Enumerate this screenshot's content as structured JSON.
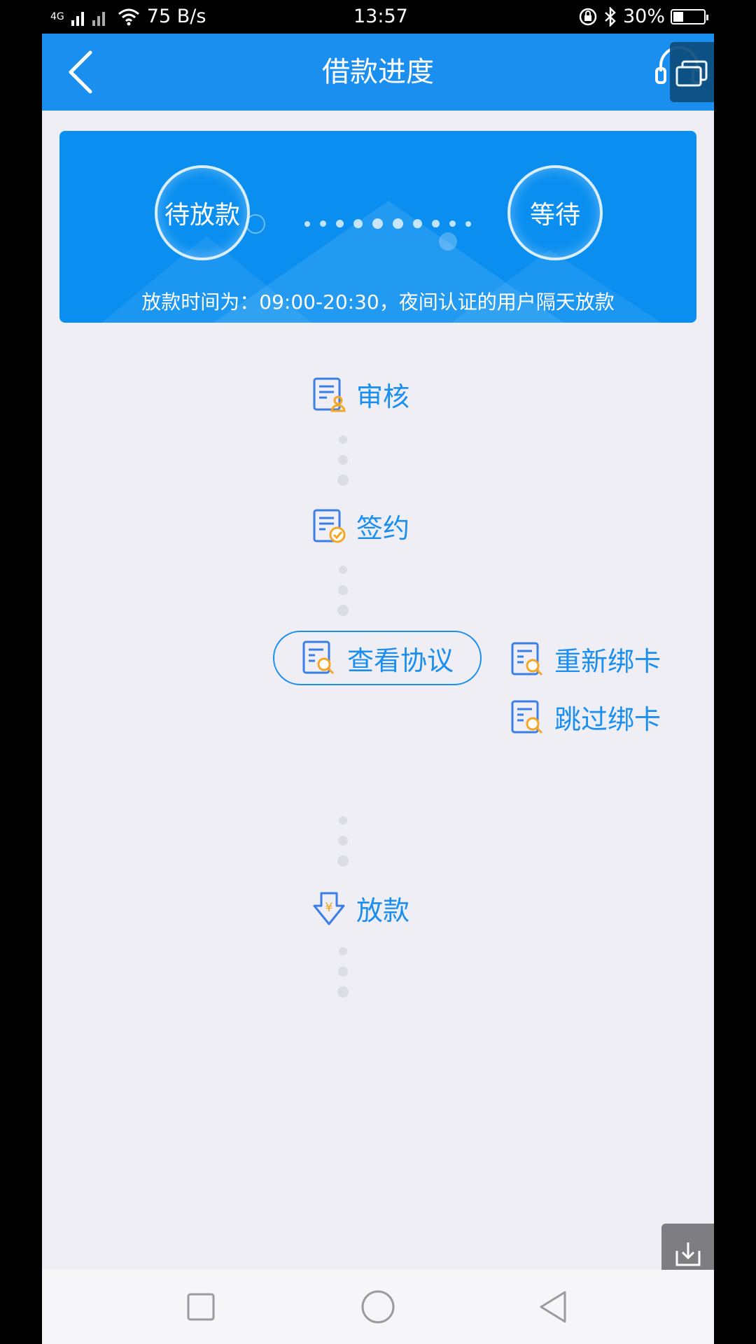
{
  "status_bar": {
    "network": "4G",
    "speed": "75 B/s",
    "time": "13:57",
    "battery": "30%",
    "battery_level": 0.3
  },
  "header": {
    "title": "借款进度"
  },
  "status_card": {
    "current_state": "待放款",
    "next_state": "等待",
    "note": "放款时间为：09:00-20:30，夜间认证的用户隔天放款"
  },
  "steps": {
    "review": "审核",
    "sign": "签约",
    "view_agreement": "查看协议",
    "rebind_card": "重新绑卡",
    "skip_bind_card": "跳过绑卡",
    "disburse": "放款"
  },
  "colors": {
    "primary": "#1a8ff0",
    "accent": "#f5a623",
    "background": "#eeeef4"
  }
}
